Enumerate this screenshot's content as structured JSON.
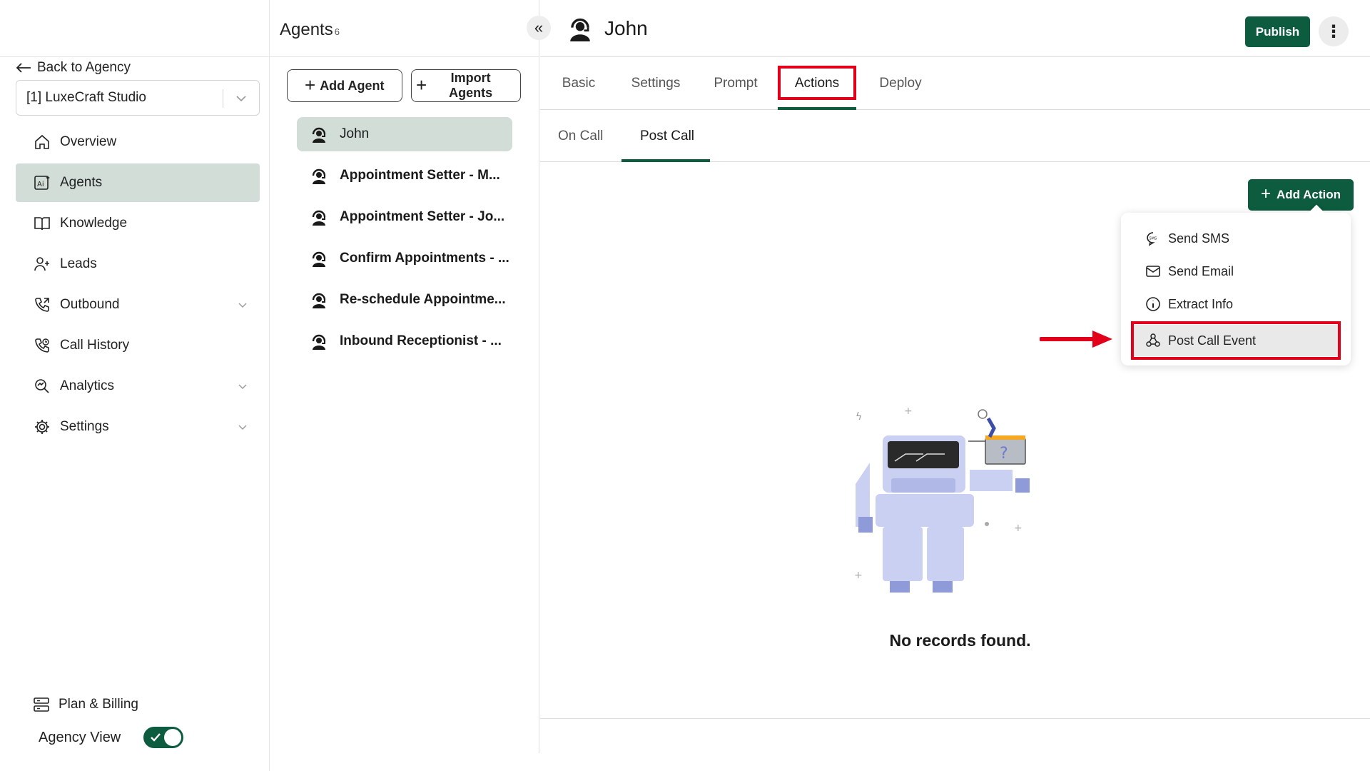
{
  "sidebar": {
    "back_label": "Back to Agency",
    "agency_select_value": "[1] LuxeCraft Studio",
    "nav": [
      {
        "label": "Overview",
        "icon": "home-icon",
        "active": false,
        "expandable": false
      },
      {
        "label": "Agents",
        "icon": "ai-icon",
        "active": true,
        "expandable": false
      },
      {
        "label": "Knowledge",
        "icon": "book-icon",
        "active": false,
        "expandable": false
      },
      {
        "label": "Leads",
        "icon": "user-add-icon",
        "active": false,
        "expandable": false
      },
      {
        "label": "Outbound",
        "icon": "phone-outgoing-icon",
        "active": false,
        "expandable": true
      },
      {
        "label": "Call History",
        "icon": "phone-history-icon",
        "active": false,
        "expandable": false
      },
      {
        "label": "Analytics",
        "icon": "analytics-icon",
        "active": false,
        "expandable": true
      },
      {
        "label": "Settings",
        "icon": "gear-icon",
        "active": false,
        "expandable": true
      }
    ],
    "plan_billing_label": "Plan & Billing",
    "agency_view_label": "Agency View",
    "agency_view_enabled": true
  },
  "agents_panel": {
    "title": "Agents",
    "count": "6",
    "add_agent_label": "Add Agent",
    "import_agents_label": "Import Agents",
    "agents": [
      {
        "name": "John",
        "active": true
      },
      {
        "name": "Appointment Setter - M...",
        "active": false
      },
      {
        "name": "Appointment Setter - Jo...",
        "active": false
      },
      {
        "name": "Confirm Appointments - ...",
        "active": false
      },
      {
        "name": "Re-schedule Appointme...",
        "active": false
      },
      {
        "name": "Inbound Receptionist - ...",
        "active": false
      }
    ]
  },
  "main": {
    "agent_name": "John",
    "publish_label": "Publish",
    "tabs": [
      "Basic",
      "Settings",
      "Prompt",
      "Actions",
      "Deploy"
    ],
    "active_tab": "Actions",
    "subtabs": [
      "On Call",
      "Post Call"
    ],
    "active_subtab": "Post Call",
    "add_action_label": "Add Action",
    "action_menu": [
      {
        "label": "Send SMS",
        "icon": "sms-icon"
      },
      {
        "label": "Send Email",
        "icon": "mail-icon"
      },
      {
        "label": "Extract Info",
        "icon": "info-icon"
      },
      {
        "label": "Post Call Event",
        "icon": "webhook-icon"
      }
    ],
    "empty_text": "No records found."
  },
  "colors": {
    "brand_green": "#0d5c3f",
    "active_nav_bg": "#d3ddd8",
    "highlight_red": "#e3001b"
  }
}
